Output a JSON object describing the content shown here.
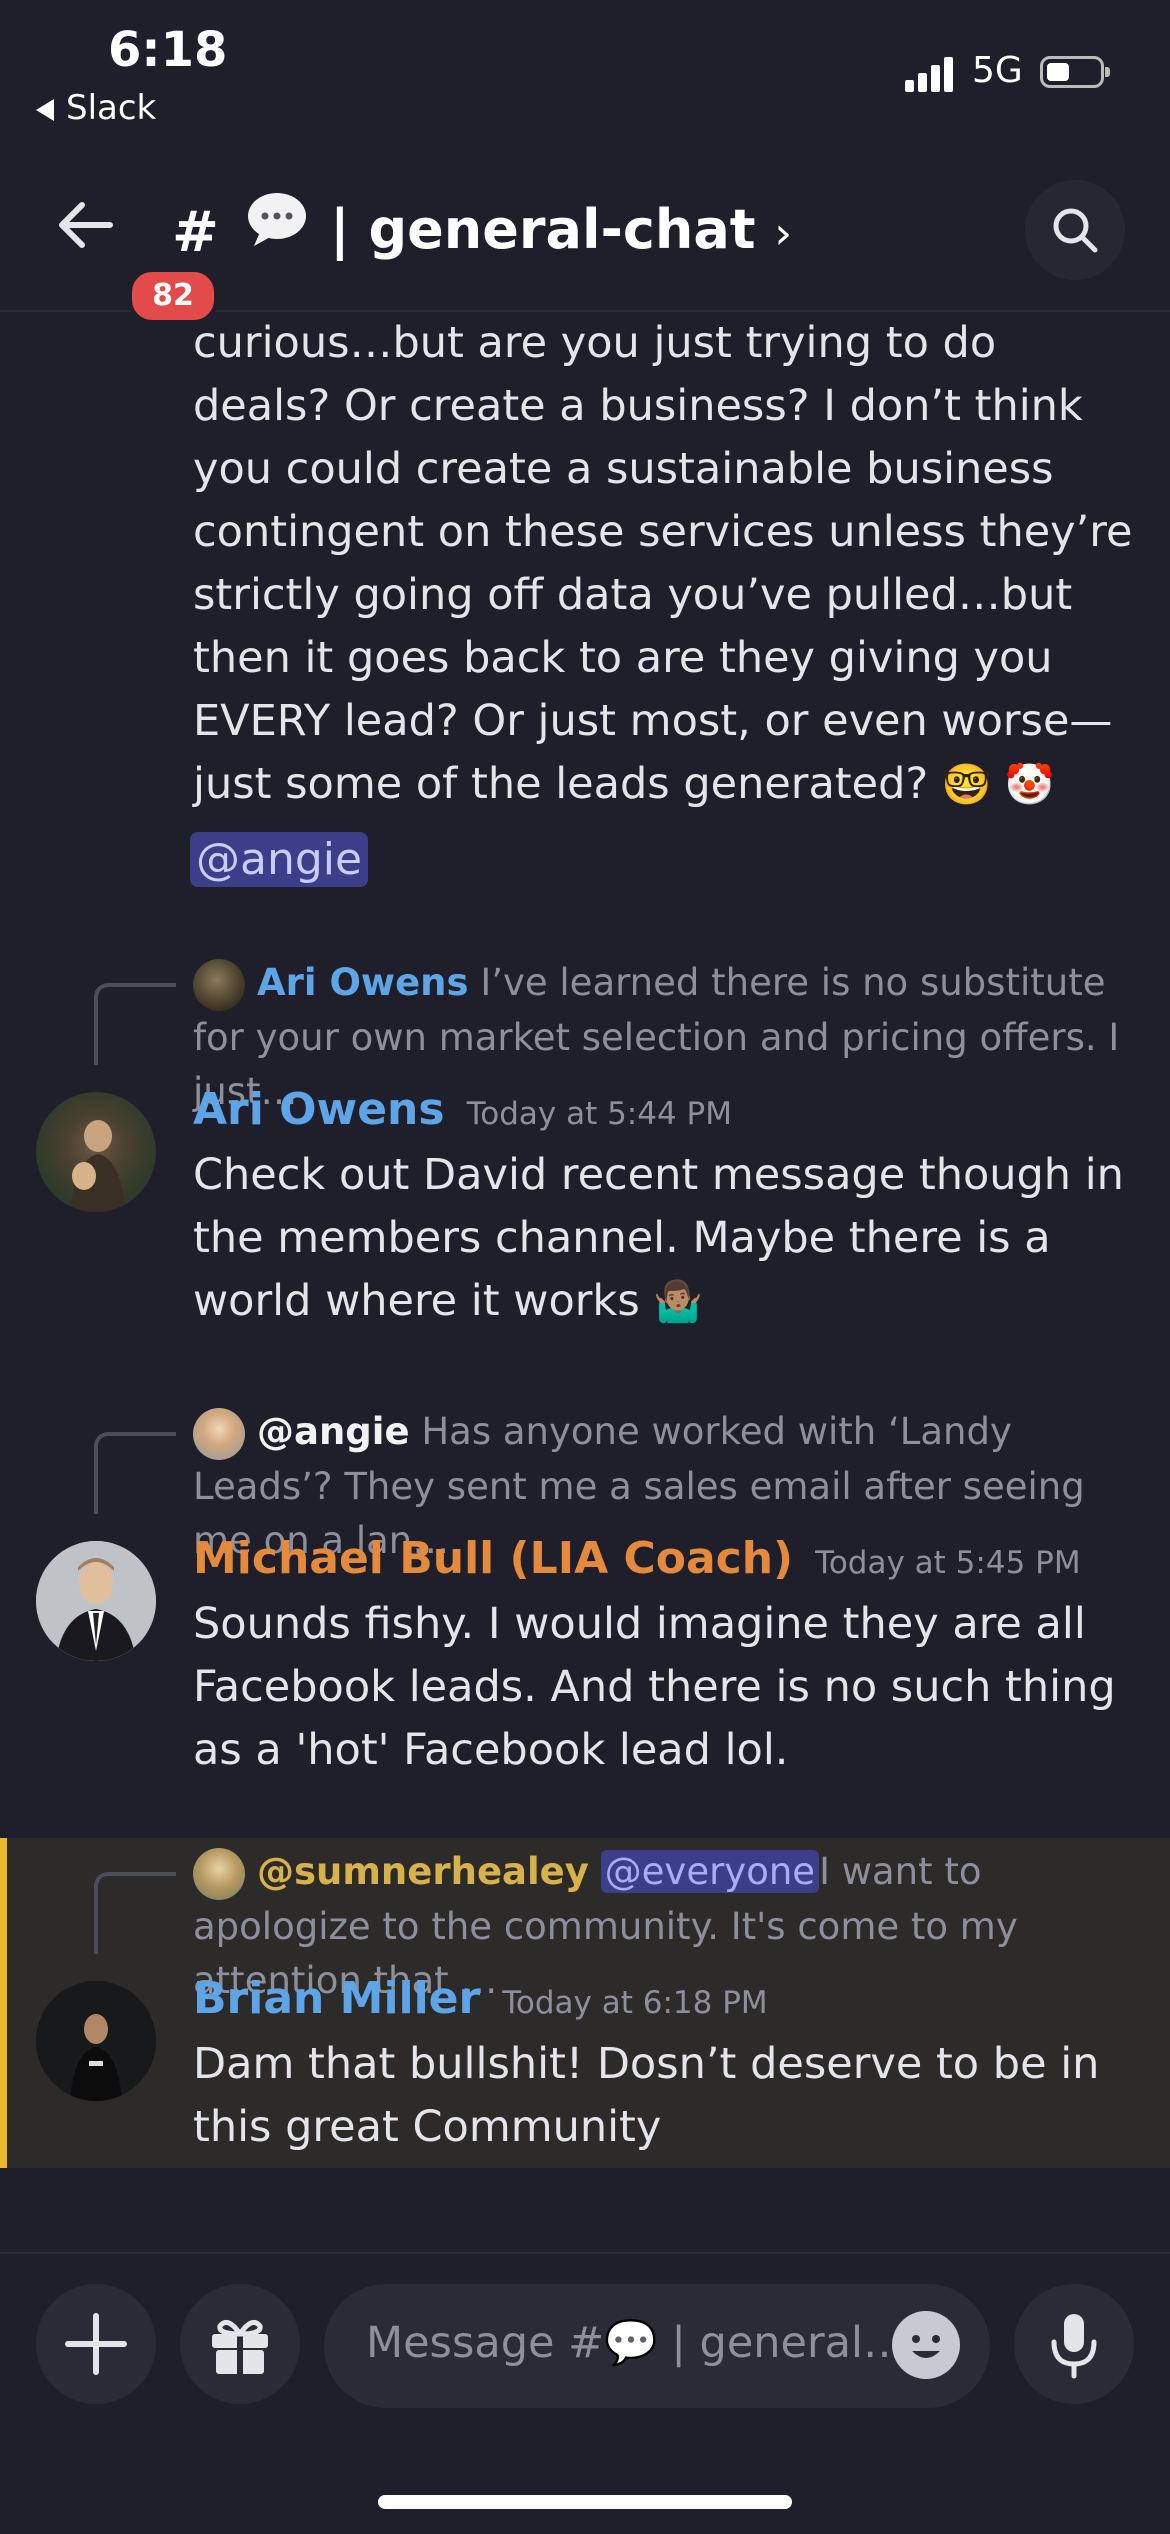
{
  "status_bar": {
    "time": "6:18",
    "back_app": "Slack",
    "network": "5G"
  },
  "header": {
    "badge_count": "82",
    "channel_hash": "#",
    "channel_name": "| general-chat",
    "chevron": "›"
  },
  "messages": [
    {
      "text": "curious…but are you just trying to do deals? Or create a business? I don’t think you could create a sustainable business contingent on these services unless they’re strictly going off data you’ve pulled…but then it goes back to are they giving you EVERY lead? Or just most, or even worse—just some of the leads generated?",
      "emojis": "🤓 🤡",
      "mention": "@angie"
    },
    {
      "reply_to_name": "Ari Owens",
      "reply_to_text": "I’ve learned there is no substitute for your own market selection and pricing offers. I just…",
      "author": "Ari Owens",
      "author_color": "#5ea5e8",
      "timestamp": "Today at 5:44 PM",
      "text": "Check out David recent message though in the members channel. Maybe there is a world where it works",
      "emoji": "🤷🏽‍♂️"
    },
    {
      "reply_to_name": "@angie",
      "reply_to_text": "Has anyone worked with ‘Landy Leads’? They sent me a sales email after seeing me on a lan…",
      "author": "Michael Bull (LIA Coach)",
      "author_color": "#e38a3c",
      "timestamp": "Today at 5:45 PM",
      "text": "Sounds fishy. I would imagine they are all Facebook leads. And there is no such thing as a 'hot' Facebook lead lol."
    },
    {
      "reply_to_name": "@sumnerhealey",
      "reply_to_mention": "@everyone",
      "reply_to_text": "I want to apologize to the community.  It's come to my attention that …",
      "author": "Brian Miller",
      "author_color": "#5ea5e8",
      "timestamp": "Today at 6:18 PM",
      "text": "Dam that bullshit!  Dosn’t deserve to be in this great Community"
    }
  ],
  "composer": {
    "placeholder": "Message #💬 | general…"
  },
  "colors": {
    "background": "#1e1f2a",
    "highlight_bar": "#e9b82c",
    "mention_bg": "#3c3e8a",
    "badge": "#e34b4b"
  }
}
